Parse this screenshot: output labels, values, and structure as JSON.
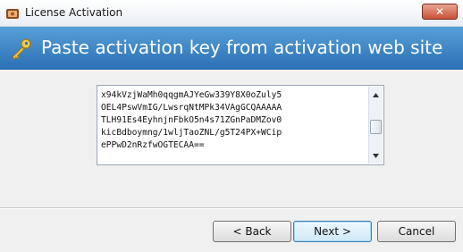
{
  "window": {
    "title": "License Activation",
    "close_label": "✕"
  },
  "header": {
    "text": "Paste activation key from activation web site"
  },
  "activation_key": {
    "lines": [
      "x94kVzjWaMh0qqgmAJYeGw339Y8X0oZuly5",
      "OEL4PswVmIG/LwsrqNtMPk34VAgGCQAAAAA",
      "TLH91Es4EyhnjnFbkO5n4s71ZGnPaDMZov0",
      "kicBdboymng/1wljTaoZNL/g5T24PX+WCip",
      "ePPwD2nRzfwOGTECAA=="
    ],
    "scroll_fraction": 0.55
  },
  "buttons": {
    "back": "< Back",
    "next": "Next >",
    "cancel": "Cancel"
  },
  "icons": {
    "app": "app-icon",
    "key": "key-icon"
  },
  "colors": {
    "header_bg": "#3b86c8",
    "close_btn": "#c9523a"
  }
}
